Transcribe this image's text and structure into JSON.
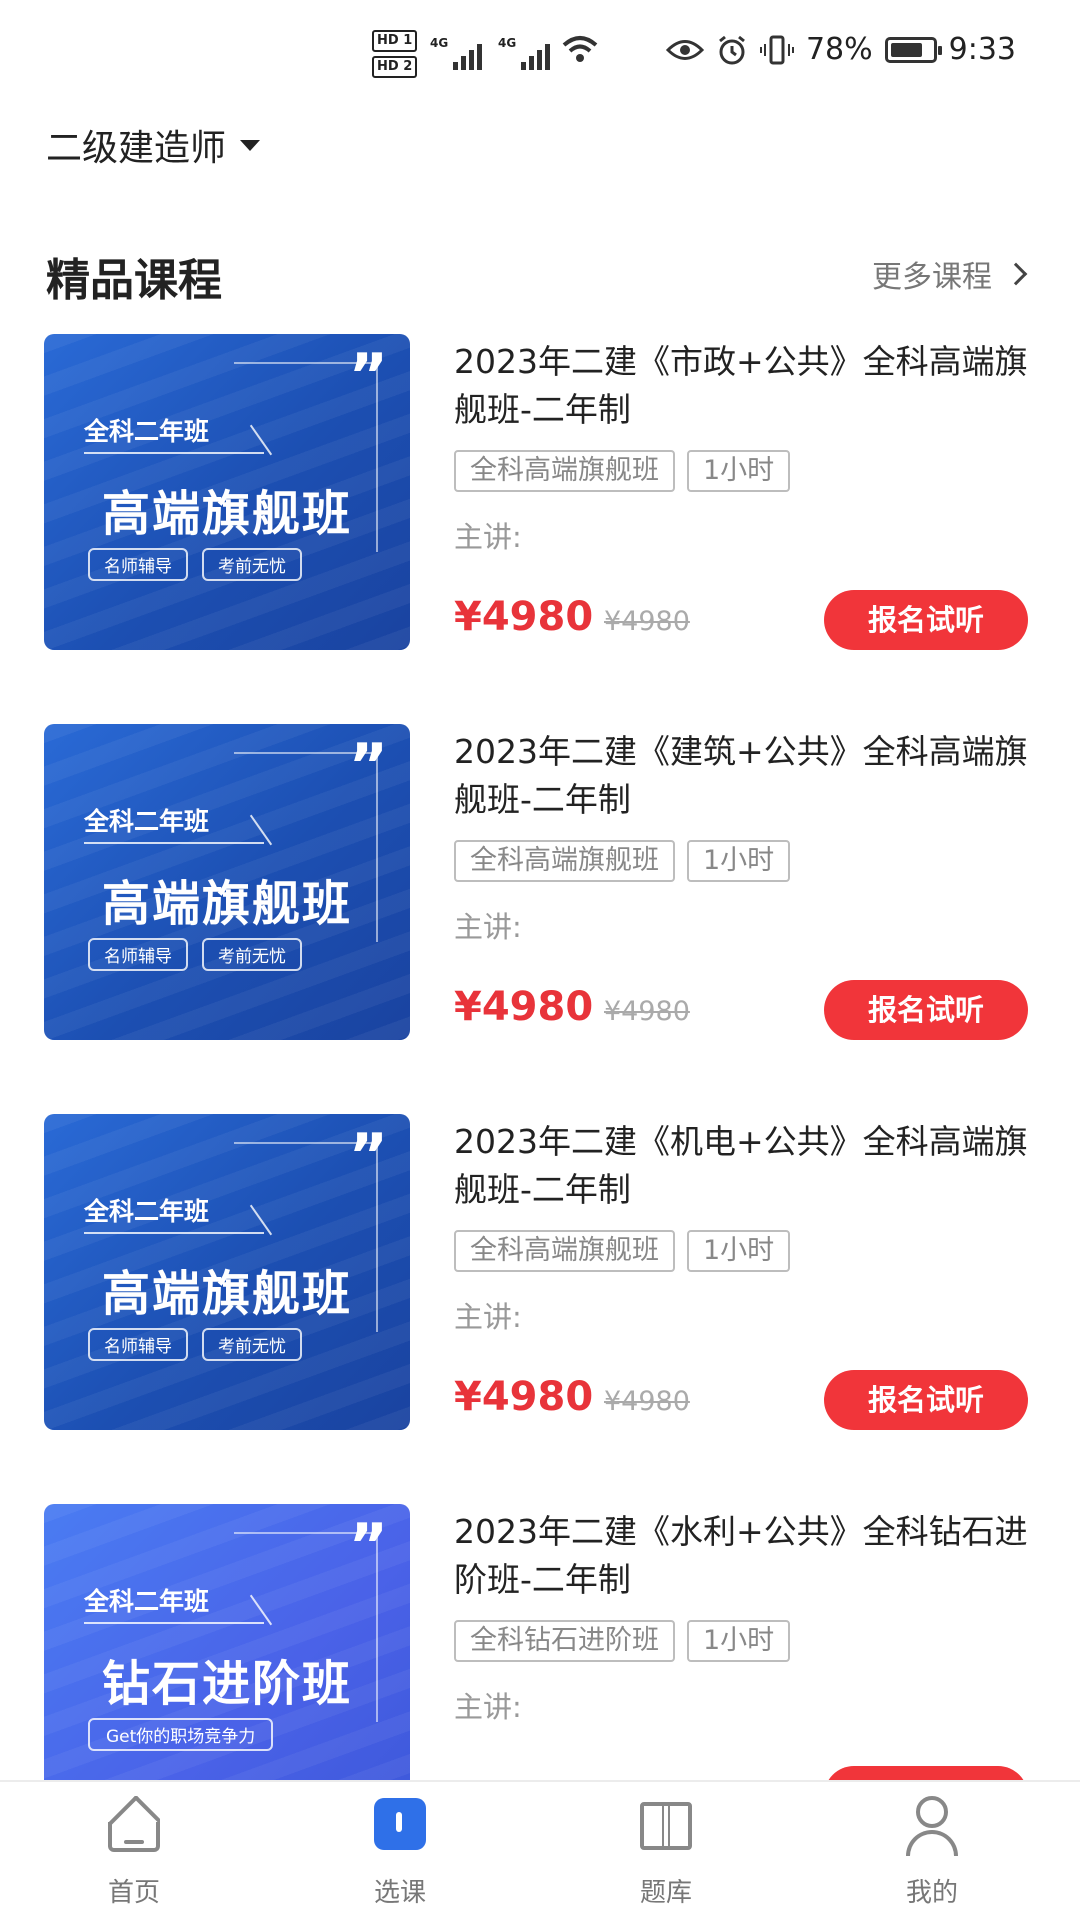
{
  "status_bar": {
    "hd1": "HD 1",
    "hd2": "HD 2",
    "net1": "4G",
    "net2": "4G",
    "battery_percent": "78%",
    "battery_level": 0.78,
    "time": "9:33",
    "icons": [
      "eye-icon",
      "alarm-icon",
      "vibrate-icon",
      "wifi-icon"
    ]
  },
  "header": {
    "exam": "二级建造师",
    "section_title": "精品课程",
    "more_label": "更多课程"
  },
  "courses": [
    {
      "title": "2023年二建《市政+公共》全科高端旗舰班-二年制",
      "tags": [
        "全科高端旗舰班",
        "1小时"
      ],
      "lecturer_label": "主讲:",
      "price": "¥4980",
      "original_price": "¥4980",
      "button": "报名试听",
      "thumb": {
        "tag": "全科二年班",
        "quote": "”",
        "big": "高端旗舰班",
        "pills": [
          "名师辅导",
          "考前无忧"
        ]
      }
    },
    {
      "title": "2023年二建《建筑+公共》全科高端旗舰班-二年制",
      "tags": [
        "全科高端旗舰班",
        "1小时"
      ],
      "lecturer_label": "主讲:",
      "price": "¥4980",
      "original_price": "¥4980",
      "button": "报名试听",
      "thumb": {
        "tag": "全科二年班",
        "quote": "”",
        "big": "高端旗舰班",
        "pills": [
          "名师辅导",
          "考前无忧"
        ]
      }
    },
    {
      "title": "2023年二建《机电+公共》全科高端旗舰班-二年制",
      "tags": [
        "全科高端旗舰班",
        "1小时"
      ],
      "lecturer_label": "主讲:",
      "price": "¥4980",
      "original_price": "¥4980",
      "button": "报名试听",
      "thumb": {
        "tag": "全科二年班",
        "quote": "”",
        "big": "高端旗舰班",
        "pills": [
          "名师辅导",
          "考前无忧"
        ]
      }
    },
    {
      "title": "2023年二建《水利+公共》全科钻石进阶班-二年制",
      "tags": [
        "全科钻石进阶班",
        "1小时"
      ],
      "lecturer_label": "主讲:",
      "thumb": {
        "tag": "全科二年班",
        "quote": "”",
        "big": "钻石进阶班",
        "pills": [
          "Get你的职场竞争力"
        ]
      }
    }
  ],
  "bottom_nav": [
    {
      "label": "首页",
      "icon": "home-icon"
    },
    {
      "label": "选课",
      "icon": "course-icon",
      "active": true
    },
    {
      "label": "题库",
      "icon": "book-icon"
    },
    {
      "label": "我的",
      "icon": "user-icon"
    }
  ],
  "colors": {
    "price_red": "#e8333a",
    "button_red": "#f1353a",
    "active_blue": "#2f70e8",
    "thumb_blue": "#1c4fb2"
  }
}
